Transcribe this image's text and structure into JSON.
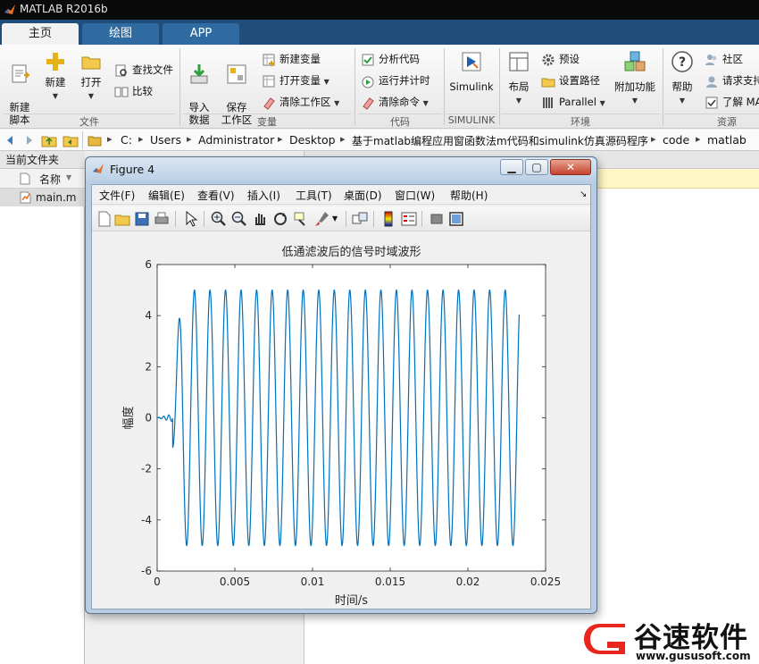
{
  "app": {
    "title": "MATLAB R2016b"
  },
  "tabs": [
    {
      "label": "主页",
      "active": true
    },
    {
      "label": "绘图",
      "active": false
    },
    {
      "label": "APP",
      "active": false
    }
  ],
  "ribbon": {
    "file": {
      "group_label": "文件",
      "new_script": "新建\n脚本",
      "new": "新建",
      "open": "打开",
      "find_files": "查找文件",
      "compare": "比较"
    },
    "variable": {
      "group_label": "变量",
      "import_data": "导入\n数据",
      "save_workspace": "保存\n工作区",
      "new_variable": "新建变量",
      "open_variable": "打开变量",
      "clear_workspace": "清除工作区"
    },
    "code": {
      "group_label": "代码",
      "analyze_code": "分析代码",
      "run_and_time": "运行并计时",
      "clear_commands": "清除命令"
    },
    "simulink": {
      "group_label": "SIMULINK",
      "label": "Simulink"
    },
    "environment": {
      "group_label": "环境",
      "layout": "布局",
      "preferences": "预设",
      "set_path": "设置路径",
      "parallel": "Parallel",
      "addons": "附加功能"
    },
    "resources": {
      "group_label": "资源",
      "help": "帮助",
      "community": "社区",
      "request_support": "请求支持",
      "learn_matlab": "了解 MA"
    }
  },
  "address": {
    "path": [
      "C:",
      "Users",
      "Administrator",
      "Desktop",
      "基于matlab编程应用窗函数法m代码和simulink仿真源码程序",
      "code",
      "matlab"
    ]
  },
  "left_panel": {
    "title": "当前文件夹",
    "column_name": "名称",
    "files": [
      "main.m"
    ]
  },
  "figure": {
    "title": "Figure 4",
    "menu": [
      "文件(F)",
      "编辑(E)",
      "查看(V)",
      "插入(I)",
      "工具(T)",
      "桌面(D)",
      "窗口(W)",
      "帮助(H)"
    ],
    "toolbar_icons": [
      "new-figure-icon",
      "open-file-icon",
      "save-icon",
      "print-icon",
      "pointer-icon",
      "zoom-in-icon",
      "zoom-out-icon",
      "pan-icon",
      "rotate-icon",
      "data-cursor-icon",
      "brush-icon",
      "link-plot-icon",
      "colorbar-icon",
      "legend-icon",
      "hide-plot-tools-icon",
      "show-plot-tools-icon"
    ]
  },
  "chart_data": {
    "type": "line",
    "title": "低通滤波后的信号时域波形",
    "xlabel": "时间/s",
    "ylabel": "幅度",
    "xlim": [
      0,
      0.025
    ],
    "ylim": [
      -6,
      6
    ],
    "xticks": [
      "0",
      "0.005",
      "0.01",
      "0.015",
      "0.02",
      "0.025"
    ],
    "yticks": [
      "-6",
      "-4",
      "-2",
      "0",
      "2",
      "4",
      "6"
    ],
    "grid": false,
    "series": [
      {
        "color": "#0072bd",
        "x_start": 0,
        "x_end": 0.0233,
        "settle_time": 0.001,
        "frequency_hz": 1000,
        "amplitude": 5,
        "phase_peak_first": 0.0014,
        "first_peak": 4.8,
        "end_value": 3.3
      }
    ]
  },
  "watermark": {
    "text": "谷速软件",
    "url": "www.gususoft.com",
    "logo_color": "#e8261d"
  }
}
